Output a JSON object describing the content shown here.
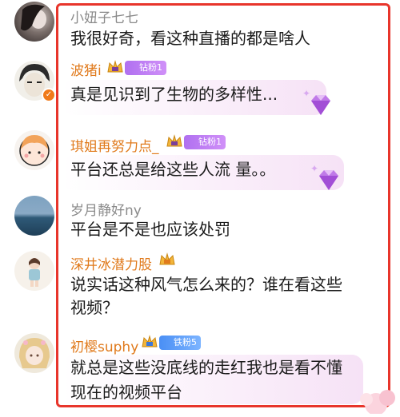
{
  "comments": [
    {
      "username": "小妞子七七",
      "text_lines": [
        "我很好奇，看这种直播的都是啥人"
      ]
    },
    {
      "username": "波猪i",
      "badge": "钻粉1",
      "text_lines": [
        "真是见识到了生物的多样性..."
      ]
    },
    {
      "username": "琪姐再努力点_",
      "badge": "钻粉1",
      "text_lines": [
        "平台还总是给这些人流 量。。"
      ]
    },
    {
      "username": "岁月静好ny",
      "text_lines": [
        "平台是不是也应该处罚"
      ]
    },
    {
      "username": "深井冰潜力股",
      "text_lines": [
        "说实话这种风气怎么来的？谁在看这些",
        "视频？"
      ]
    },
    {
      "username": "初樱suphy",
      "badge": "铁粉5",
      "text_lines": [
        "就总是这些没底线的走红我也是看不懂",
        "现在的视频平台"
      ]
    }
  ],
  "colors": {
    "frame": "#e8352b",
    "username_gold": "#e07a1c",
    "username_gray": "#8a8a8a",
    "badge_purple": "#b070f0",
    "badge_blue": "#4a8ff5",
    "verified": "#f07a1a"
  },
  "icons": [
    "crown-icon",
    "diamond-gem-icon",
    "verified-badge-icon",
    "sparkle-icon"
  ]
}
